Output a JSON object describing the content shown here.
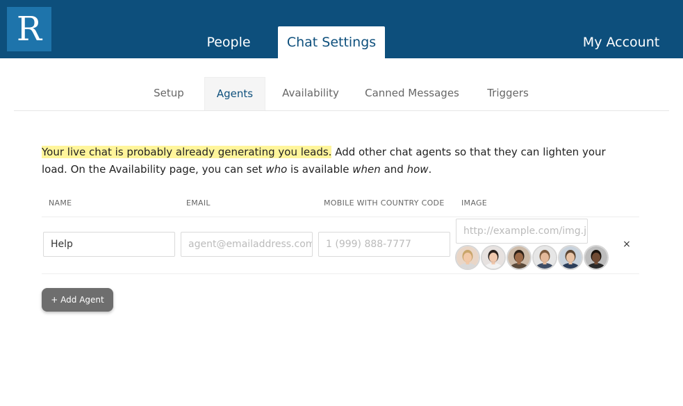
{
  "logo": {
    "letter": "R"
  },
  "top_nav": {
    "people": "People",
    "chat_settings": "Chat Settings",
    "my_account": "My Account"
  },
  "sub_nav": {
    "setup": "Setup",
    "agents": "Agents",
    "availability": "Availability",
    "canned_messages": "Canned Messages",
    "triggers": "Triggers"
  },
  "intro": {
    "highlight": "Your live chat is probably already generating you leads.",
    "part1": " Add other chat agents so that they can lighten your load. On the Availability page, you can set ",
    "who": "who",
    "part2": " is available ",
    "when": "when",
    "part3": " and ",
    "how": "how",
    "part4": "."
  },
  "table": {
    "headers": [
      "NAME",
      "EMAIL",
      "MOBILE WITH COUNTRY CODE",
      "IMAGE"
    ],
    "row": {
      "name_value": "Help",
      "email_placeholder": "agent@emailaddress.com",
      "mobile_placeholder": "1 (999) 888-7777",
      "image_placeholder": "http://example.com/img.jpg",
      "remove_label": "×"
    },
    "avatars": [
      {
        "name": "avatar-1",
        "bg": "#e9d6c7",
        "skin": "#f2c9a8",
        "hair": "#c9a56a",
        "shirt": "#d9d9d9"
      },
      {
        "name": "avatar-2",
        "bg": "#e7e2e0",
        "skin": "#f0c8ad",
        "hair": "#2b211c",
        "shirt": "#f2f2f2"
      },
      {
        "name": "avatar-3",
        "bg": "#cdbba9",
        "skin": "#9c6a48",
        "hair": "#2f2218",
        "shirt": "#5a4a3a"
      },
      {
        "name": "avatar-4",
        "bg": "#e6e6e6",
        "skin": "#e3b99a",
        "hair": "#7a5a3d",
        "shirt": "#3f4e66"
      },
      {
        "name": "avatar-5",
        "bg": "#c8d2dc",
        "skin": "#e8c3a6",
        "hair": "#5c4633",
        "shirt": "#2c3e5a"
      },
      {
        "name": "avatar-6",
        "bg": "#bdbdbd",
        "skin": "#6f4a33",
        "hair": "#1a120c",
        "shirt": "#2a2a2a"
      }
    ]
  },
  "add_agent_button": "+ Add Agent",
  "colors": {
    "header_bg": "#0d4f7c",
    "logo_bg": "#1e74ab",
    "highlight": "#fff59b",
    "button_bg": "#6e6e6e"
  }
}
